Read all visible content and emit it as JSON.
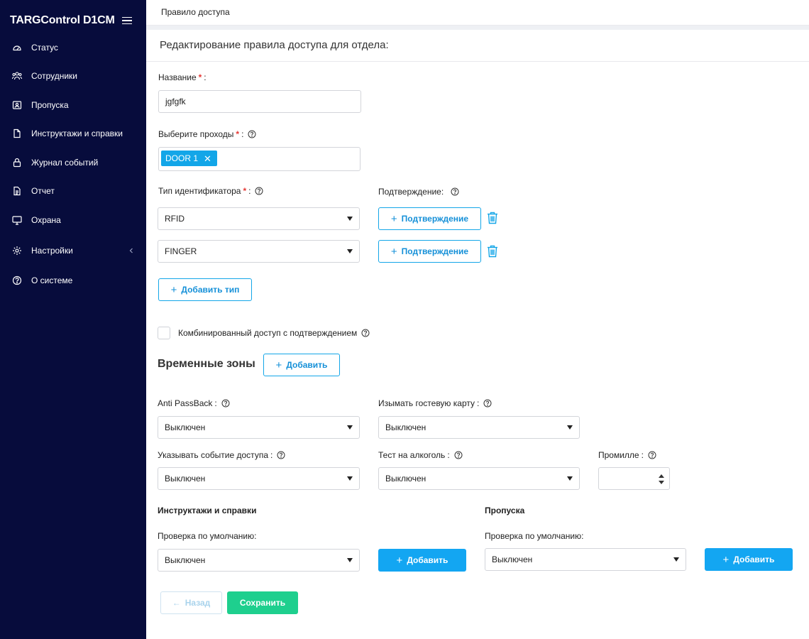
{
  "sidebar": {
    "brand": "TARGControl D1CM",
    "items": [
      {
        "label": "Статус",
        "icon": "dashboard-icon"
      },
      {
        "label": "Сотрудники",
        "icon": "users-icon"
      },
      {
        "label": "Пропуска",
        "icon": "badge-icon"
      },
      {
        "label": "Инструктажи и справки",
        "icon": "document-icon"
      },
      {
        "label": "Журнал событий",
        "icon": "lock-icon"
      },
      {
        "label": "Отчет",
        "icon": "report-icon"
      },
      {
        "label": "Охрана",
        "icon": "monitor-icon"
      },
      {
        "label": "Настройки",
        "icon": "gear-icon"
      },
      {
        "label": "О системе",
        "icon": "help-icon"
      }
    ]
  },
  "header": {
    "title": "Правило доступа"
  },
  "card": {
    "title": "Редактирование правила доступа для отдела:"
  },
  "form": {
    "name": {
      "label": "Название",
      "value": "jgfgfk"
    },
    "passages": {
      "label": "Выберите проходы",
      "tags": [
        "DOOR 1"
      ]
    },
    "id_type": {
      "label": "Тип идентификатора",
      "confirm_label": "Подтверждение:",
      "rows": [
        {
          "value": "RFID",
          "confirm_button": "Подтверждение"
        },
        {
          "value": "FINGER",
          "confirm_button": "Подтверждение"
        }
      ],
      "add_type_button": "Добавить тип"
    },
    "combined": {
      "label": "Комбинированный доступ с подтверждением",
      "checked": false
    },
    "time_zones": {
      "title": "Временные зоны",
      "add_button": "Добавить"
    },
    "anti_passback": {
      "label": "Anti PassBack",
      "value": "Выключен"
    },
    "guest_card": {
      "label": "Изымать гостевую карту",
      "value": "Выключен"
    },
    "access_event": {
      "label": "Указывать событие доступа",
      "value": "Выключен"
    },
    "alcohol": {
      "label": "Тест на алкоголь",
      "value": "Выключен"
    },
    "promille": {
      "label": "Промилле",
      "value": ""
    },
    "briefings": {
      "title": "Инструктажи и справки",
      "default_check_label": "Проверка по умолчанию:",
      "value": "Выключен",
      "add_button": "Добавить"
    },
    "passes": {
      "title": "Пропуска",
      "default_check_label": "Проверка по умолчанию:",
      "value": "Выключен",
      "add_button": "Добавить"
    },
    "back_button": "Назад",
    "save_button": "Сохранить"
  },
  "colors": {
    "sidebar_bg": "#070c3c",
    "accent": "#13a6e8",
    "save_green": "#1ecf8e",
    "required": "#e53935"
  }
}
